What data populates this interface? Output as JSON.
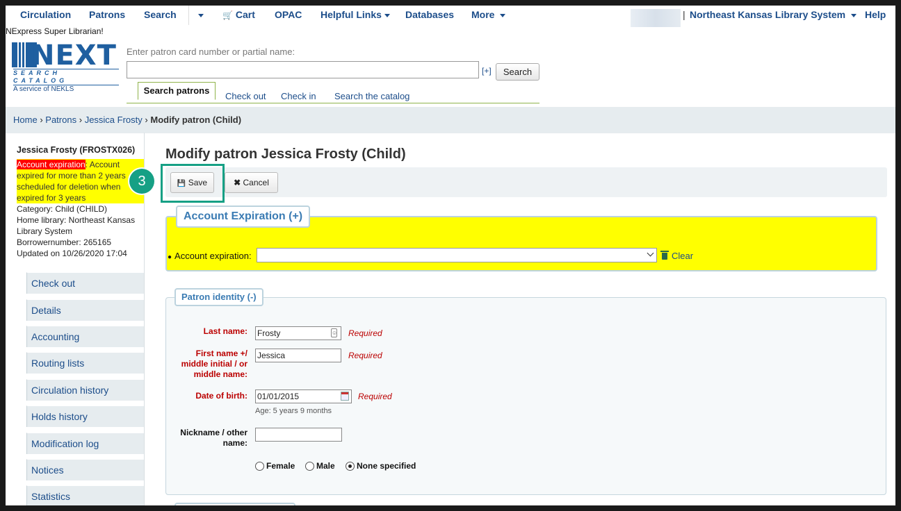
{
  "nav": {
    "items": [
      "Circulation",
      "Patrons",
      "Search",
      "Cart",
      "OPAC",
      "Helpful Links",
      "Databases",
      "More"
    ],
    "library": "Northeast Kansas Library System",
    "help": "Help",
    "user_label": "NExpress Super Librarian!"
  },
  "logo": {
    "main": "NEXT",
    "sub": "SEARCH CATALOG",
    "service": "A service of NEKLS"
  },
  "search": {
    "label": "Enter patron card number or partial name:",
    "value": "",
    "plus": "[+]",
    "button": "Search",
    "tabs": [
      "Search patrons",
      "Check out",
      "Check in",
      "Search the catalog"
    ]
  },
  "breadcrumb": {
    "home": "Home",
    "patrons": "Patrons",
    "patron": "Jessica Frosty",
    "current": "Modify patron (Child)",
    "sep": "›"
  },
  "patron": {
    "name": "Jessica Frosty (FROSTX026)",
    "exp_label": "Account expiration",
    "exp_text": ": Account expired for more than 2 years scheduled for deletion when expired for 3 years",
    "category": "Category: Child (CHILD)",
    "home_library": "Home library: Northeast Kansas Library System",
    "borrowernumber": "Borrowernumber: 265165",
    "updated": "Updated on 10/26/2020 17:04"
  },
  "sidenav": [
    "Check out",
    "Details",
    "Accounting",
    "Routing lists",
    "Circulation history",
    "Holds history",
    "Modification log",
    "Notices",
    "Statistics"
  ],
  "main": {
    "title": "Modify patron Jessica Frosty (Child)",
    "save": "Save",
    "cancel": "Cancel",
    "step": "3",
    "exp_legend": "Account Expiration (+)",
    "exp_field_label": "Account expiration:",
    "exp_value": "",
    "clear": "Clear",
    "id_legend": "Patron identity (-)",
    "fields": {
      "last_name_label": "Last name:",
      "last_name": "Frosty",
      "first_name_label": "First name +/ middle initial / or middle name:",
      "first_name": "Jessica",
      "dob_label": "Date of birth:",
      "dob": "01/01/2015",
      "age": "Age: 5 years 9 months",
      "nickname_label": "Nickname / other name:",
      "nickname": "",
      "required": "Required"
    },
    "gender": {
      "female": "Female",
      "male": "Male",
      "none": "None specified",
      "selected": "None specified"
    }
  },
  "colors": {
    "link": "#1c4d8a",
    "highlight": "#ffff00",
    "warning_label": "#ff0000",
    "step": "#16a085"
  }
}
